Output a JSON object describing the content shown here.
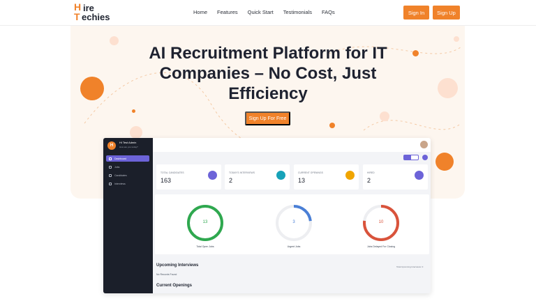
{
  "brand": {
    "logo_line1": "ire",
    "logo_line2": "echies"
  },
  "nav": {
    "links": [
      "Home",
      "Features",
      "Quick Start",
      "Testimonials",
      "FAQs"
    ],
    "signin": "Sign In",
    "signup": "Sign Up"
  },
  "hero": {
    "title": "AI Recruitment Platform for IT Companies – No Cost, Just Efficiency",
    "cta": "Sign Up For Free"
  },
  "dashboard": {
    "user_name": "Hi Test Admin",
    "user_sub": "How are you today?",
    "sidebar": [
      "Dashboard",
      "Jobs",
      "Candidates",
      "Interviews"
    ],
    "stats": [
      {
        "label": "TOTAL CANDIDATES",
        "value": "163",
        "color": "#6c63d8"
      },
      {
        "label": "TODAY'S INTERVIEWS",
        "value": "2",
        "color": "#17a2b8"
      },
      {
        "label": "CURRENT OPENINGS",
        "value": "13",
        "color": "#f0a500"
      },
      {
        "label": "HIRED",
        "value": "2",
        "color": "#6c63d8"
      }
    ],
    "rings": [
      {
        "value": "13",
        "caption": "Total Open Jobs",
        "color": "#2fa84f",
        "fraction": 1.0
      },
      {
        "value": "3",
        "caption": "Urgent Jobs",
        "color": "#4a7fd6",
        "fraction": 0.23
      },
      {
        "value": "10",
        "caption": "Jobs Delayed For Closing",
        "color": "#d9533b",
        "fraction": 0.77
      }
    ],
    "upcoming_title": "Upcoming Interviews",
    "upcoming_link": "Total Upcoming Interviews: 0",
    "no_records": "No Records Found",
    "openings_title": "Current Openings"
  },
  "colors": {
    "accent": "#f0822a",
    "hero_bg": "#fdf6ef",
    "sidebar": "#1b1f2a",
    "primary": "#6c63d8"
  }
}
